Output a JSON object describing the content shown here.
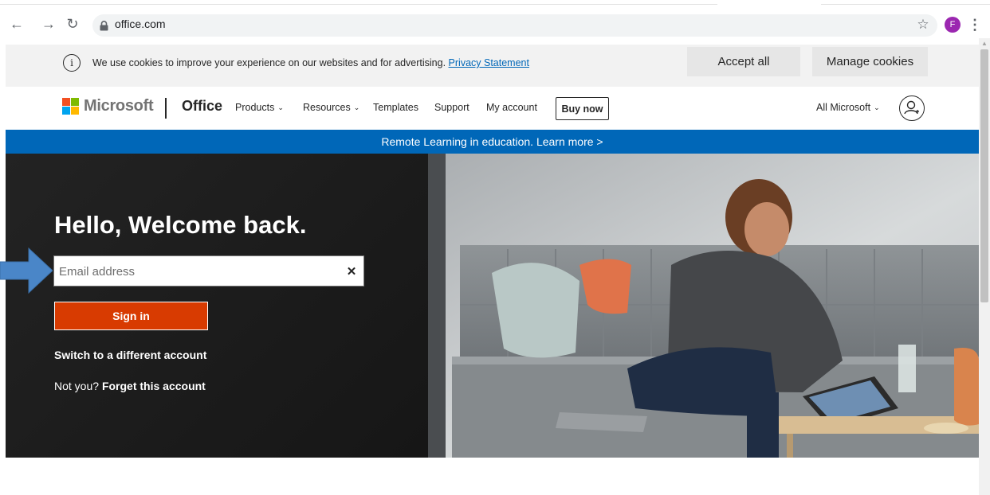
{
  "browser": {
    "url": "office.com",
    "profile_initial": "F"
  },
  "cookie_banner": {
    "text": "We use cookies to improve your experience on our websites and for advertising.",
    "link": "Privacy Statement",
    "accept": "Accept all",
    "manage": "Manage cookies"
  },
  "header": {
    "brand": "Microsoft",
    "product": "Office",
    "nav": [
      {
        "label": "Products",
        "dropdown": true
      },
      {
        "label": "Resources",
        "dropdown": true
      },
      {
        "label": "Templates",
        "dropdown": false
      },
      {
        "label": "Support",
        "dropdown": false
      },
      {
        "label": "My account",
        "dropdown": false
      }
    ],
    "buy_now": "Buy now",
    "all_microsoft": "All Microsoft"
  },
  "promo_banner": {
    "text": "Remote Learning in education. Learn more >"
  },
  "hero": {
    "title": "Hello, Welcome back.",
    "email_placeholder": "Email address",
    "email_value": "",
    "sign_in": "Sign in",
    "switch_account": "Switch to a different account",
    "not_you": "Not you?",
    "forget": "Forget this account"
  },
  "colors": {
    "ms_red": "#f25022",
    "ms_green": "#7fba00",
    "ms_blue": "#00a4ef",
    "ms_yellow": "#ffb900",
    "promo_blue": "#0067b8",
    "sign_in_orange": "#d83b01",
    "annotation_arrow": "#4a86c8"
  }
}
